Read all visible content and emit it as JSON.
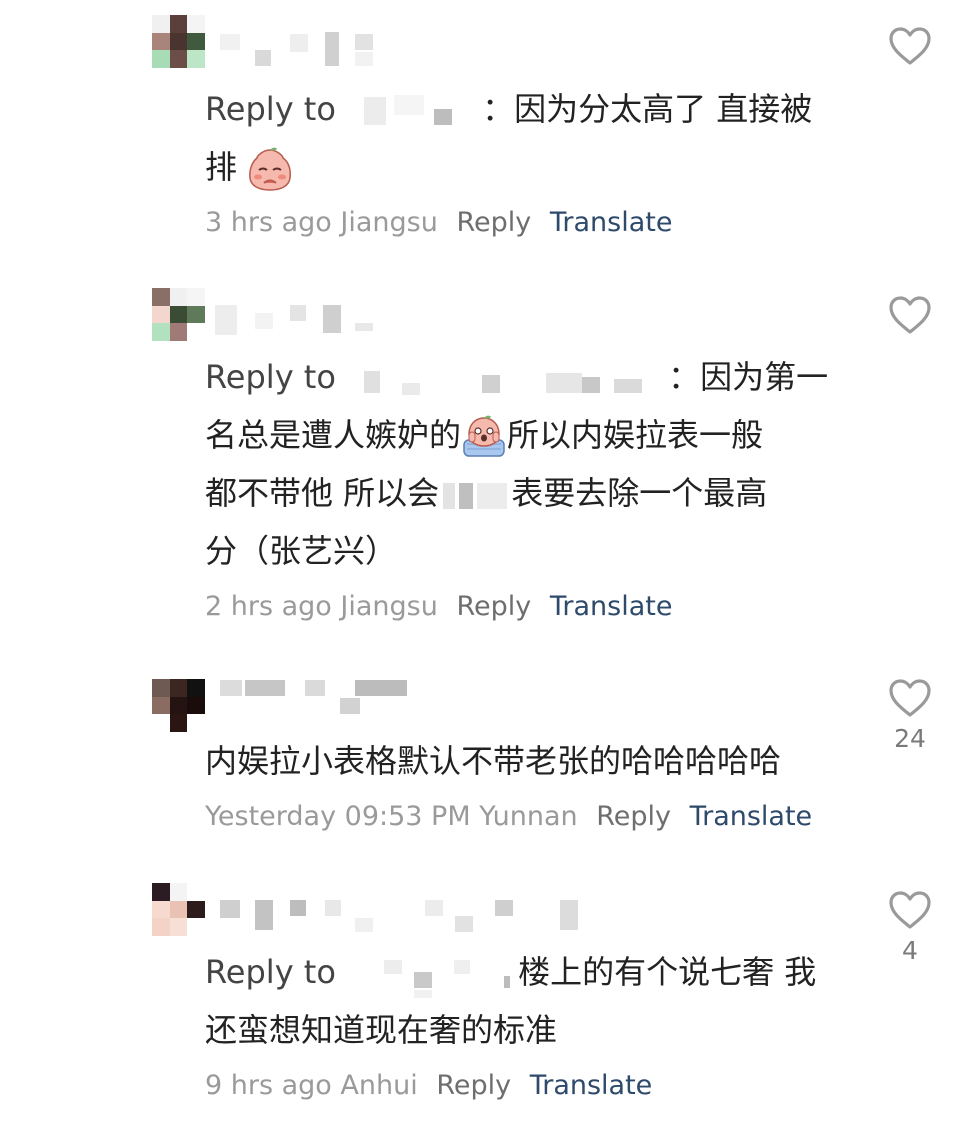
{
  "comments": [
    {
      "reply_prefix": "Reply to",
      "text_lines": [
        "：因为分太高了 直接被",
        "排"
      ],
      "time": "3 hrs ago",
      "location": "Jiangsu",
      "reply_label": "Reply",
      "translate_label": "Translate",
      "like_count": "",
      "emoji": "shy-peach-emoji"
    },
    {
      "reply_prefix": "Reply to",
      "text_lines": [
        "：因为第一",
        "名总是遭人嫉妒的",
        "所以内娱拉表一般",
        "都不带他 所以会",
        "表要去除一个最高",
        "分（张艺兴）"
      ],
      "time": "2 hrs ago",
      "location": "Jiangsu",
      "reply_label": "Reply",
      "translate_label": "Translate",
      "like_count": "",
      "emoji": "scared-peach-emoji"
    },
    {
      "text_lines": [
        "内娱拉小表格默认不带老张的哈哈哈哈哈"
      ],
      "time": "Yesterday 09:53 PM",
      "location": "Yunnan",
      "reply_label": "Reply",
      "translate_label": "Translate",
      "like_count": "24"
    },
    {
      "reply_prefix": "Reply to",
      "text_lines": [
        "楼上的有个说七奢 我",
        "还蛮想知道现在奢的标准"
      ],
      "time": "9 hrs ago",
      "location": "Anhui",
      "reply_label": "Reply",
      "translate_label": "Translate",
      "like_count": "4"
    }
  ],
  "colors": {
    "text": "#222222",
    "meta": "#9a9a9a",
    "reply": "#6e6e6e",
    "translate": "#2e4a6b",
    "heart": "#9a9a9a"
  },
  "icons": [
    "heart-outline-icon"
  ]
}
